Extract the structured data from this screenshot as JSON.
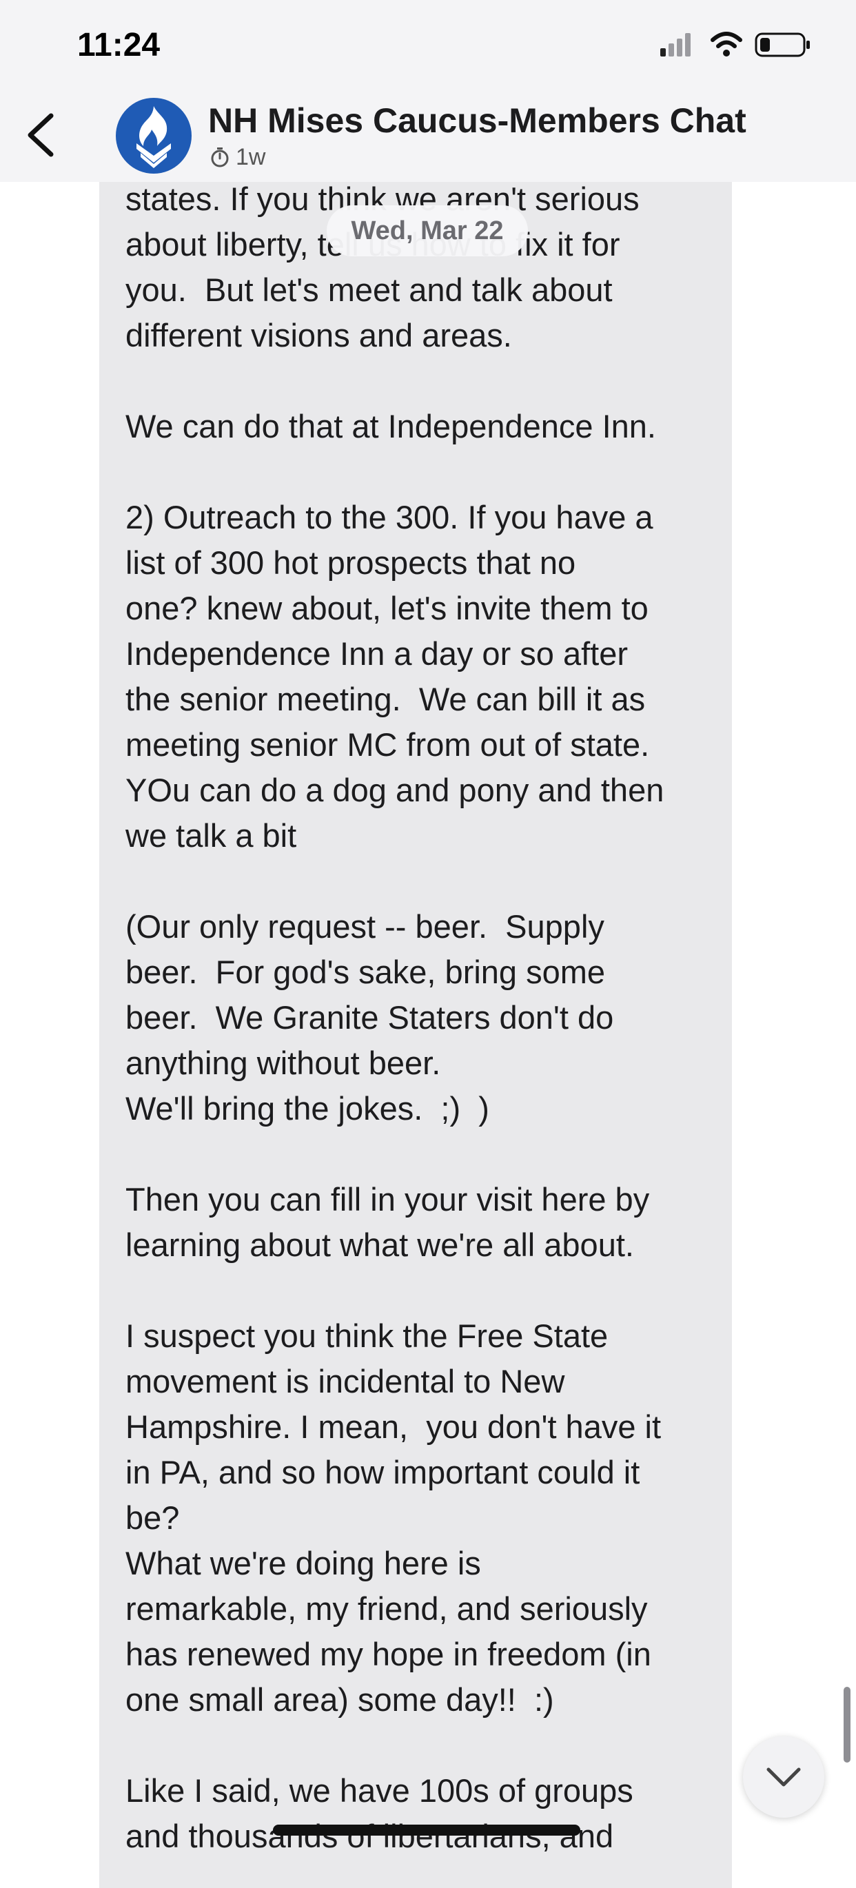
{
  "status_bar": {
    "time": "11:24"
  },
  "header": {
    "title": "NH Mises Caucus-Members Chat",
    "timer_label": "1w"
  },
  "date_separator": "Wed, Mar 22",
  "message": {
    "text": "states. If you think we aren't serious\nabout liberty, tell us how to fix it for\nyou.  But let's meet and talk about\ndifferent visions and areas.\n\nWe can do that at Independence Inn.\n\n2) Outreach to the 300. If you have a\nlist of 300 hot prospects that no\none? knew about, let's invite them to\nIndependence Inn a day or so after\nthe senior meeting.  We can bill it as\nmeeting senior MC from out of state.\nYOu can do a dog and pony and then\nwe talk a bit\n\n(Our only request -- beer.  Supply\nbeer.  For god's sake, bring some\nbeer.  We Granite Staters don't do\nanything without beer.\nWe'll bring the jokes.  ;)  )\n\nThen you can fill in your visit here by\nlearning about what we're all about.\n\nI suspect you think the Free State\nmovement is incidental to New\nHampshire. I mean,  you don't have it\nin PA, and so how important could it\nbe?\nWhat we're doing here is\nremarkable, my friend, and seriously\nhas renewed my hope in freedom (in\none small area) some day!!  :)\n\nLike I said, we have 100s of groups\nand thousands of libertarians, and"
  },
  "icons": {
    "back": "chevron-left-icon",
    "avatar": "flame-logo",
    "timer": "timer-icon",
    "scroll_down": "chevron-down-icon"
  },
  "colors": {
    "avatar_bg": "#1f5bb5",
    "bubble_bg": "#e9e9eb",
    "header_bg": "#f4f4f6"
  }
}
